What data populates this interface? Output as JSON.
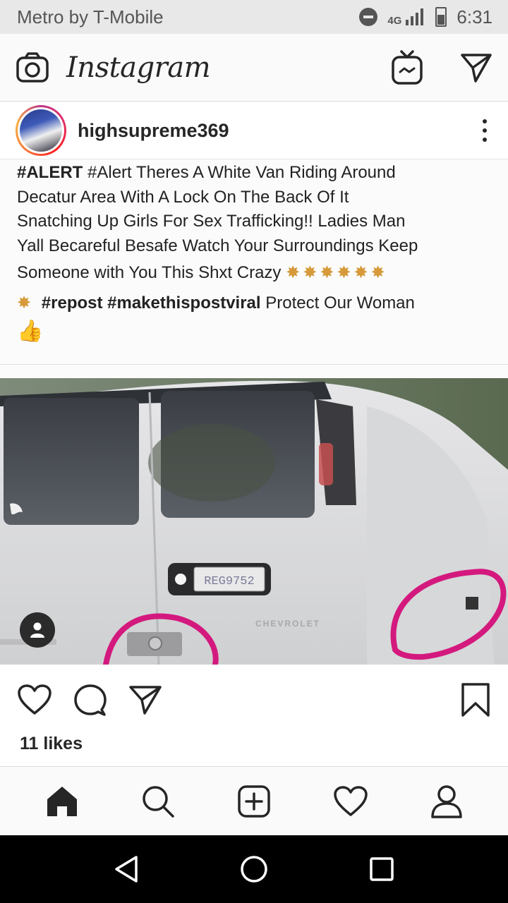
{
  "status_bar": {
    "carrier": "Metro by T-Mobile",
    "network": "4G",
    "time": "6:31",
    "icons": [
      "do-not-disturb-icon",
      "signal-icon",
      "battery-icon"
    ]
  },
  "app_bar": {
    "logo_text": "Instagram",
    "icons": [
      "camera-icon",
      "igtv-icon",
      "direct-message-icon"
    ]
  },
  "post": {
    "username": "highsupreme369",
    "caption_lines": [
      {
        "bold": "#ALERT",
        "text": " #Alert Theres A White Van Riding Around"
      },
      {
        "bold": "",
        "text": "Decatur Area With A Lock On The Back Of It"
      },
      {
        "bold": "",
        "text": "Snatching Up Girls For Sex Trafficking!! Ladies Man"
      },
      {
        "bold": "",
        "text": "Yall Becareful Besafe Watch Your Surroundings Keep"
      },
      {
        "bold": "",
        "text": "Someone with You This Shxt Crazy "
      }
    ],
    "caption_last_line": {
      "bold": "#repost #makethispostviral",
      "text": " Protect Our Woman"
    },
    "photo": {
      "license_plate": "REG9752",
      "vehicle_badge": "CHEVROLET",
      "highlight_color": "#d4197e"
    },
    "likes": "11 likes"
  },
  "action_icons": [
    "like-icon",
    "comment-icon",
    "share-icon",
    "bookmark-icon"
  ],
  "bottom_nav": [
    "home-icon",
    "search-icon",
    "new-post-icon",
    "activity-icon",
    "profile-icon"
  ],
  "system_nav": [
    "back-icon",
    "home-circle-icon",
    "recents-icon"
  ],
  "colors": {
    "status_bar_bg": "#e8e8e8",
    "text_primary": "#262626",
    "border": "#dbdbdb",
    "sysnav_bg": "#000000"
  }
}
